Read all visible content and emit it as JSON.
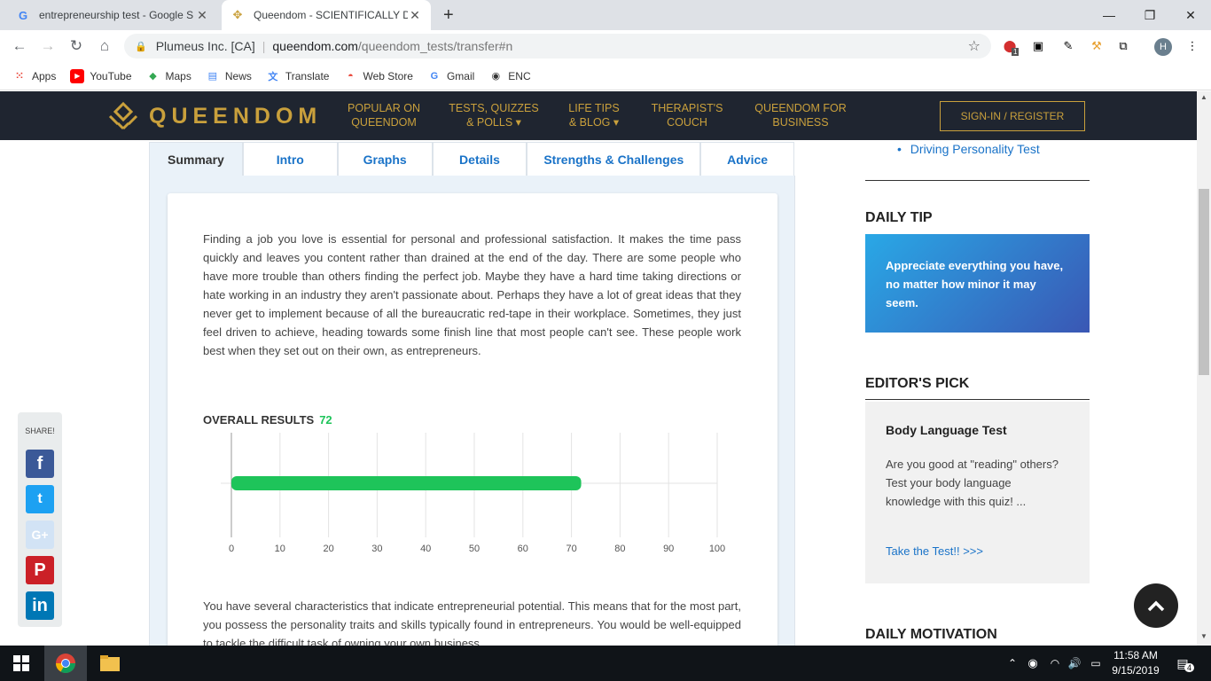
{
  "browser": {
    "tabs": [
      {
        "title": "entrepreneurship test - Google S",
        "icon": "google-icon"
      },
      {
        "title": "Queendom - SCIENTIFICALLY DE",
        "icon": "queendom-icon"
      }
    ],
    "address": {
      "org": "Plumeus Inc. [CA]",
      "domain": "queendom.com",
      "path": "/queendom_tests/transfer#n"
    },
    "profile_initial": "H",
    "extension_badge": "1",
    "bookmarks": [
      "Apps",
      "YouTube",
      "Maps",
      "News",
      "Translate",
      "Web Store",
      "Gmail",
      "ENC"
    ]
  },
  "site": {
    "logo_text": "QUEENDOM",
    "menu": [
      {
        "line1": "POPULAR ON",
        "line2": "QUEENDOM"
      },
      {
        "line1": "TESTS, QUIZZES",
        "line2": "& POLLS ▾"
      },
      {
        "line1": "LIFE TIPS",
        "line2": "& BLOG ▾"
      },
      {
        "line1": "THERAPIST'S",
        "line2": "COUCH"
      },
      {
        "line1": "QUEENDOM FOR",
        "line2": "BUSINESS"
      }
    ],
    "signin": "SIGN-IN / REGISTER",
    "brand_color": "#c9a03c"
  },
  "result": {
    "tabs": [
      "Summary",
      "Intro",
      "Graphs",
      "Details",
      "Strengths & Challenges",
      "Advice"
    ],
    "intro": "Finding a job you love is essential for personal and professional satisfaction. It makes the time pass quickly and leaves you content rather than drained at the end of the day. There are some people who have more trouble than others finding the perfect job. Maybe they have a hard time taking directions or hate working in an industry they aren't passionate about. Perhaps they have a lot of great ideas that they never get to implement because of all the bureaucratic red-tape in their workplace. Sometimes, they just feel driven to achieve, heading towards some finish line that most people can't see. These people work best when they set out on their own, as entrepreneurs.",
    "overall_label": "OVERALL RESULTS",
    "overall_score": "72",
    "followup": "You have several characteristics that indicate entrepreneurial potential. This means that for the most part, you possess the personality traits and skills typically found in entrepreneurs. You would be well-equipped to tackle the difficult task of owning your own business."
  },
  "chart_data": {
    "type": "bar",
    "orientation": "horizontal",
    "categories": [
      ""
    ],
    "values": [
      72
    ],
    "xlim": [
      0,
      100
    ],
    "xticks": [
      0,
      10,
      20,
      30,
      40,
      50,
      60,
      70,
      80,
      90,
      100
    ],
    "bar_color": "#1ec45a",
    "grid": true
  },
  "share": {
    "label": "SHARE!",
    "buttons": [
      "f",
      "t",
      "G+",
      "P",
      "in"
    ]
  },
  "sidebar": {
    "link": "Driving Personality Test",
    "daily_tip_heading": "DAILY TIP",
    "daily_tip": "Appreciate everything you have, no matter how minor it may seem.",
    "editors_pick_heading": "EDITOR'S PICK",
    "pick_title": "Body Language Test",
    "pick_desc": "Are you good at \"reading\" others? Test your body language knowledge with this quiz! ...",
    "pick_link": "Take the Test!! >>>",
    "daily_motivation_heading": "DAILY MOTIVATION"
  },
  "taskbar": {
    "time": "11:58 AM",
    "date": "9/15/2019",
    "notifications": "4"
  }
}
